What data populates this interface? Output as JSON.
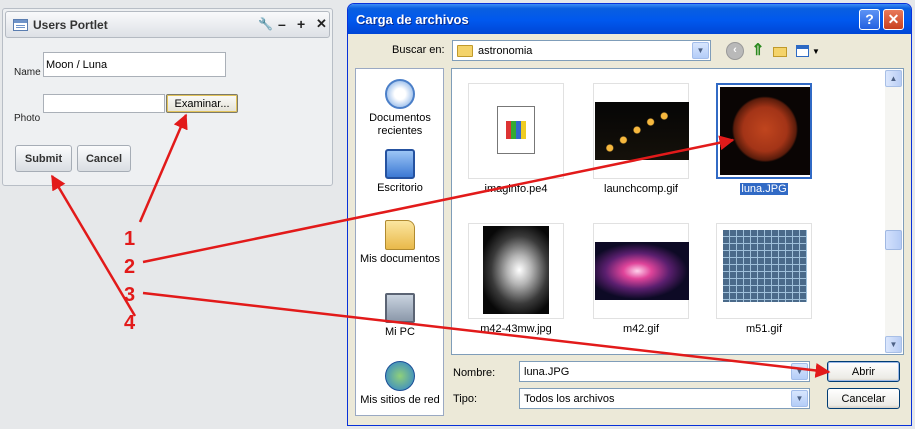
{
  "portlet": {
    "title": "Users Portlet",
    "tool_wrench": "🔧",
    "tool_minimize": "–",
    "tool_maximize": "+",
    "tool_close": "✕",
    "name_label": "Name",
    "name_value": "Moon / Luna",
    "photo_label": "Photo",
    "photo_value": "",
    "browse_label": "Examinar...",
    "submit_label": "Submit",
    "cancel_label": "Cancel"
  },
  "dialog": {
    "title": "Carga de archivos",
    "help_glyph": "?",
    "close_glyph": "✕",
    "look_in_label": "Buscar en:",
    "look_in_value": "astronomia",
    "places": [
      {
        "label": "Documentos recientes",
        "icon": "recent-documents-icon"
      },
      {
        "label": "Escritorio",
        "icon": "desktop-icon"
      },
      {
        "label": "Mis documentos",
        "icon": "my-documents-icon"
      },
      {
        "label": "Mi PC",
        "icon": "my-computer-icon"
      },
      {
        "label": "Mis sitios de red",
        "icon": "network-places-icon"
      }
    ],
    "files": [
      {
        "name": "imaginfo.pe4",
        "selected": false
      },
      {
        "name": "launchcomp.gif",
        "selected": false
      },
      {
        "name": "luna.JPG",
        "selected": true
      },
      {
        "name": "m42-43mw.jpg",
        "selected": false
      },
      {
        "name": "m42.gif",
        "selected": false
      },
      {
        "name": "m51.gif",
        "selected": false
      }
    ],
    "filename_label": "Nombre:",
    "filename_value": "luna.JPG",
    "filetype_label": "Tipo:",
    "filetype_value": "Todos los archivos",
    "open_label": "Abrir",
    "cancel_label": "Cancelar"
  },
  "annotations": {
    "color": "#e21a1a",
    "step_labels": [
      "1",
      "2",
      "3",
      "4"
    ]
  }
}
